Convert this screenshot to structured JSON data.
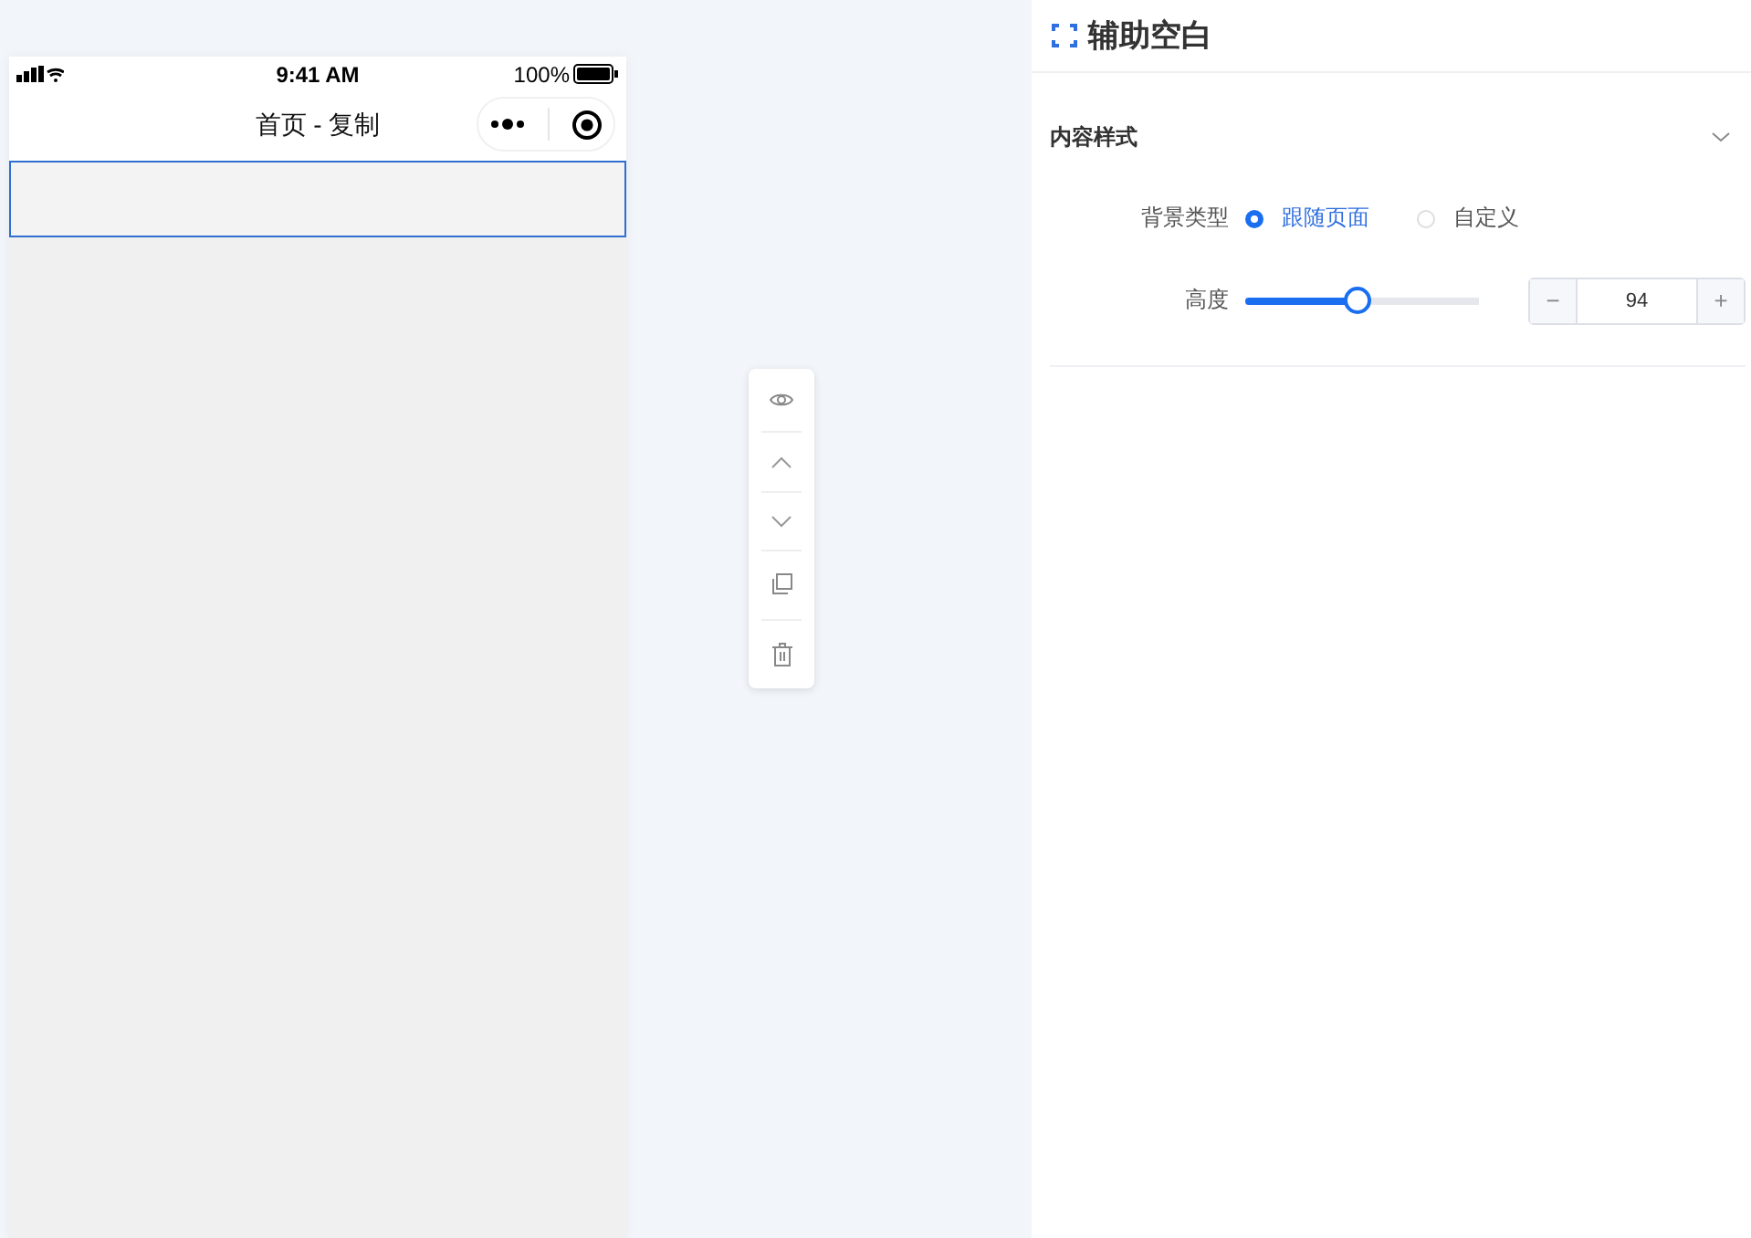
{
  "status_bar": {
    "time": "9:41 AM",
    "battery": "100%"
  },
  "nav": {
    "title": "首页 - 复制"
  },
  "panel": {
    "title": "辅助空白",
    "section": {
      "title": "内容样式",
      "expanded": true
    },
    "background_type": {
      "label": "背景类型",
      "options": [
        {
          "label": "跟随页面",
          "selected": true
        },
        {
          "label": "自定义",
          "selected": false
        }
      ]
    },
    "height": {
      "label": "高度",
      "level": 0.48,
      "value": "94",
      "minus": "−",
      "plus": "+"
    }
  }
}
